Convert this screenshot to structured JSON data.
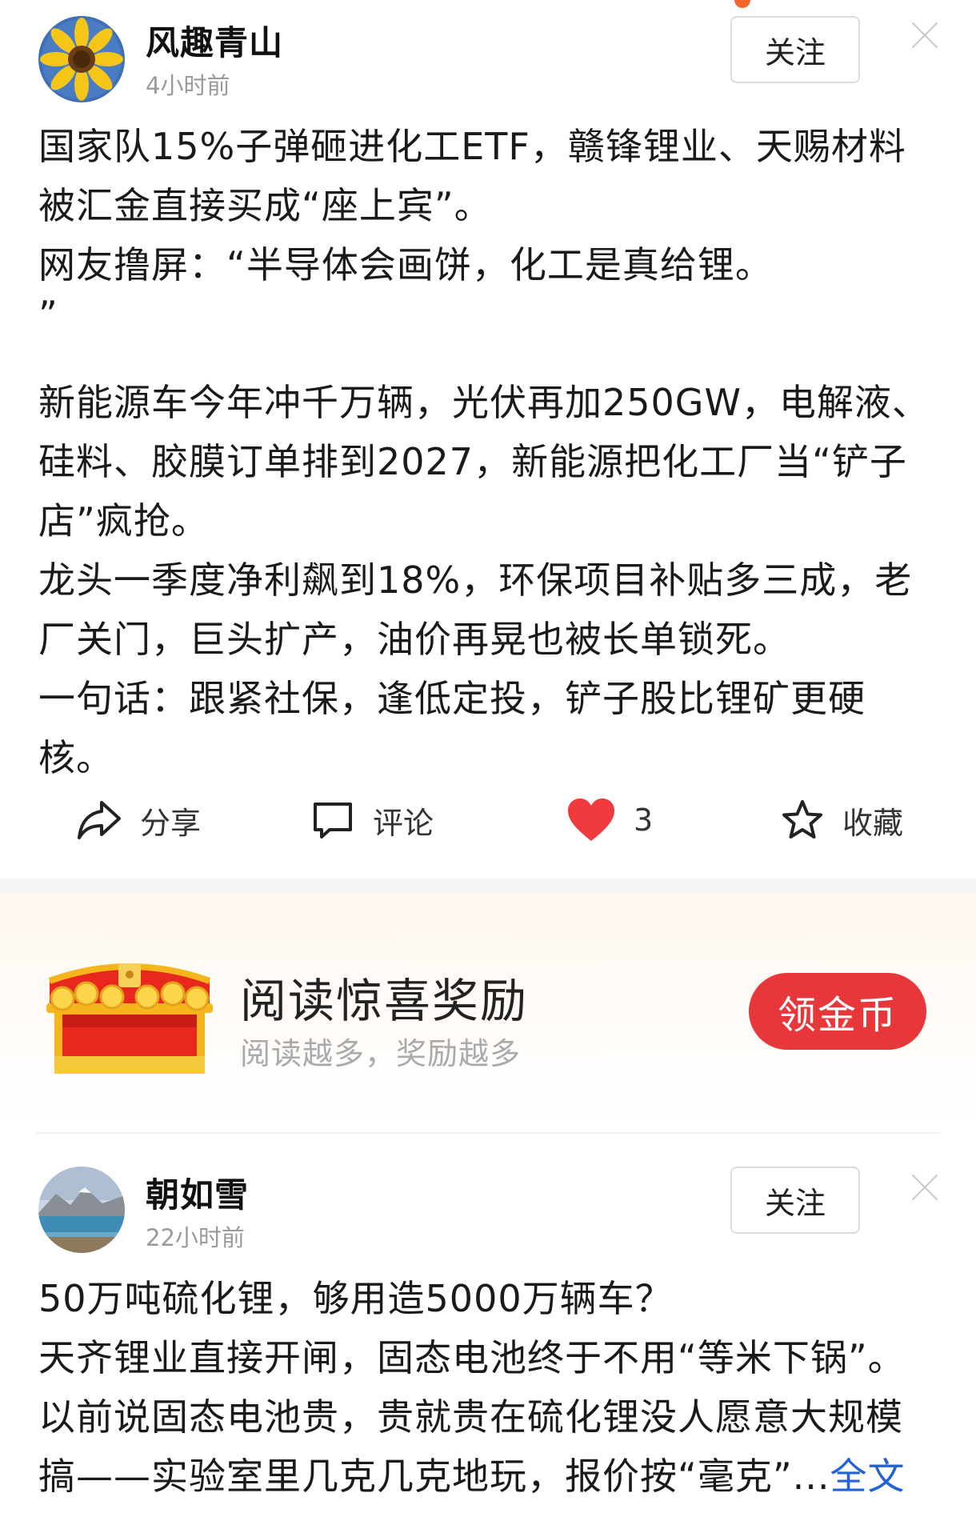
{
  "post1": {
    "author": "风趣青山",
    "time": "4小时前",
    "follow_label": "关注",
    "lines": [
      "国家队15%子弹砸进化工ETF，赣锋锂业、天赐材料",
      "被汇金直接买成“座上宾”。",
      "网友撸屏：“半导体会画饼，化工是真给锂。",
      "”",
      "",
      "新能源车今年冲千万辆，光伏再加250GW，电解液、",
      "硅料、胶膜订单排到2027，新能源把化工厂当“铲子",
      "店”疯抢。",
      "龙头一季度净利飙到18%，环保项目补贴多三成，老",
      "厂关门，巨头扩产，油价再晃也被长单锁死。",
      "一句话：跟紧社保，逢低定投，铲子股比锂矿更硬",
      "核。"
    ],
    "actions": {
      "share": "分享",
      "comment": "评论",
      "like_count": "3",
      "favorite": "收藏"
    }
  },
  "reward": {
    "title": "阅读惊喜奖励",
    "subtitle": "阅读越多，奖励越多",
    "button": "领金币"
  },
  "post2": {
    "author": "朝如雪",
    "time": "22小时前",
    "follow_label": "关注",
    "lines": [
      "50万吨硫化锂，够用造5000万辆车？",
      "天齐锂业直接开闸，固态电池终于不用“等米下锅”。",
      "以前说固态电池贵，贵就贵在硫化锂没人愿意大规模",
      "搞——实验室里几克几克地玩，报价按“毫克”..."
    ],
    "full_text_link": "全文"
  },
  "colors": {
    "accent_red": "#e8373b",
    "like_red": "#f03a3e",
    "link_blue": "#2463d6"
  },
  "icons": [
    "share-icon",
    "comment-icon",
    "heart-icon",
    "star-icon",
    "close-icon",
    "treasure-chest-icon"
  ]
}
